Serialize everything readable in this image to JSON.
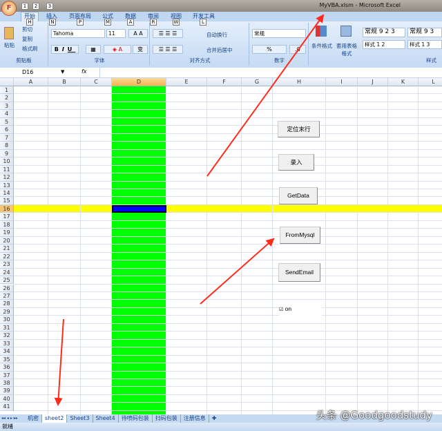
{
  "window": {
    "title": "MyVBA.xlsm - Microsoft Excel",
    "office_button": "F",
    "quick_access": [
      "1",
      "2",
      "3"
    ]
  },
  "ribbon": {
    "tabs": [
      {
        "label": "开始",
        "key": "H"
      },
      {
        "label": "插入",
        "key": "N"
      },
      {
        "label": "页面布局",
        "key": "P"
      },
      {
        "label": "公式",
        "key": "M"
      },
      {
        "label": "数据",
        "key": "A"
      },
      {
        "label": "审阅",
        "key": "R"
      },
      {
        "label": "视图",
        "key": "W"
      },
      {
        "label": "开发工具",
        "key": "L"
      }
    ],
    "clipboard": {
      "paste": "粘贴",
      "cut": "剪切",
      "copy": "复制",
      "format_painter": "格式刷",
      "label": "剪贴板"
    },
    "font": {
      "name": "Tahoma",
      "size": "11",
      "bold": "B",
      "italic": "I",
      "underline": "U",
      "label": "字体"
    },
    "alignment": {
      "wrap": "自动换行",
      "merge": "合并后居中",
      "label": "对齐方式"
    },
    "number": {
      "format": "常规",
      "percent": "%",
      "comma": ",",
      "label": "数字"
    },
    "styles": {
      "conditional": "条件格式",
      "table": "套用表格格式",
      "cells": [
        "常规 9 2 3",
        "常规 9 3",
        "样式 1 2",
        "样式 1 3"
      ],
      "label": "样式"
    }
  },
  "formula_bar": {
    "name_box": "D16",
    "fx": "fx",
    "value": ""
  },
  "sheet": {
    "columns": [
      "A",
      "B",
      "C",
      "D",
      "E",
      "F",
      "G",
      "H",
      "I",
      "J",
      "K",
      "L"
    ],
    "selected_cell": "D16",
    "selected_row": 16,
    "selected_column": "D",
    "row_count": 41,
    "colors": {
      "column_fill": "#00ff00",
      "row_fill": "#ffff00",
      "cell_fill": "#0000ff"
    }
  },
  "controls": {
    "buttons": [
      "定位末行",
      "录入",
      "GetData",
      "FromMysql",
      "SendEmail"
    ],
    "checkbox": {
      "label": "on",
      "checked": true
    }
  },
  "sheet_tabs": [
    "机密",
    "sheet2",
    "Sheet3",
    "Sheet4",
    "待喷码包装",
    "扫码包装",
    "注册信息"
  ],
  "active_sheet": "sheet2",
  "status": {
    "text": "就绪"
  },
  "watermark": "头条 @Goodgoodstudy",
  "annotation_color": "#ff2a1a"
}
